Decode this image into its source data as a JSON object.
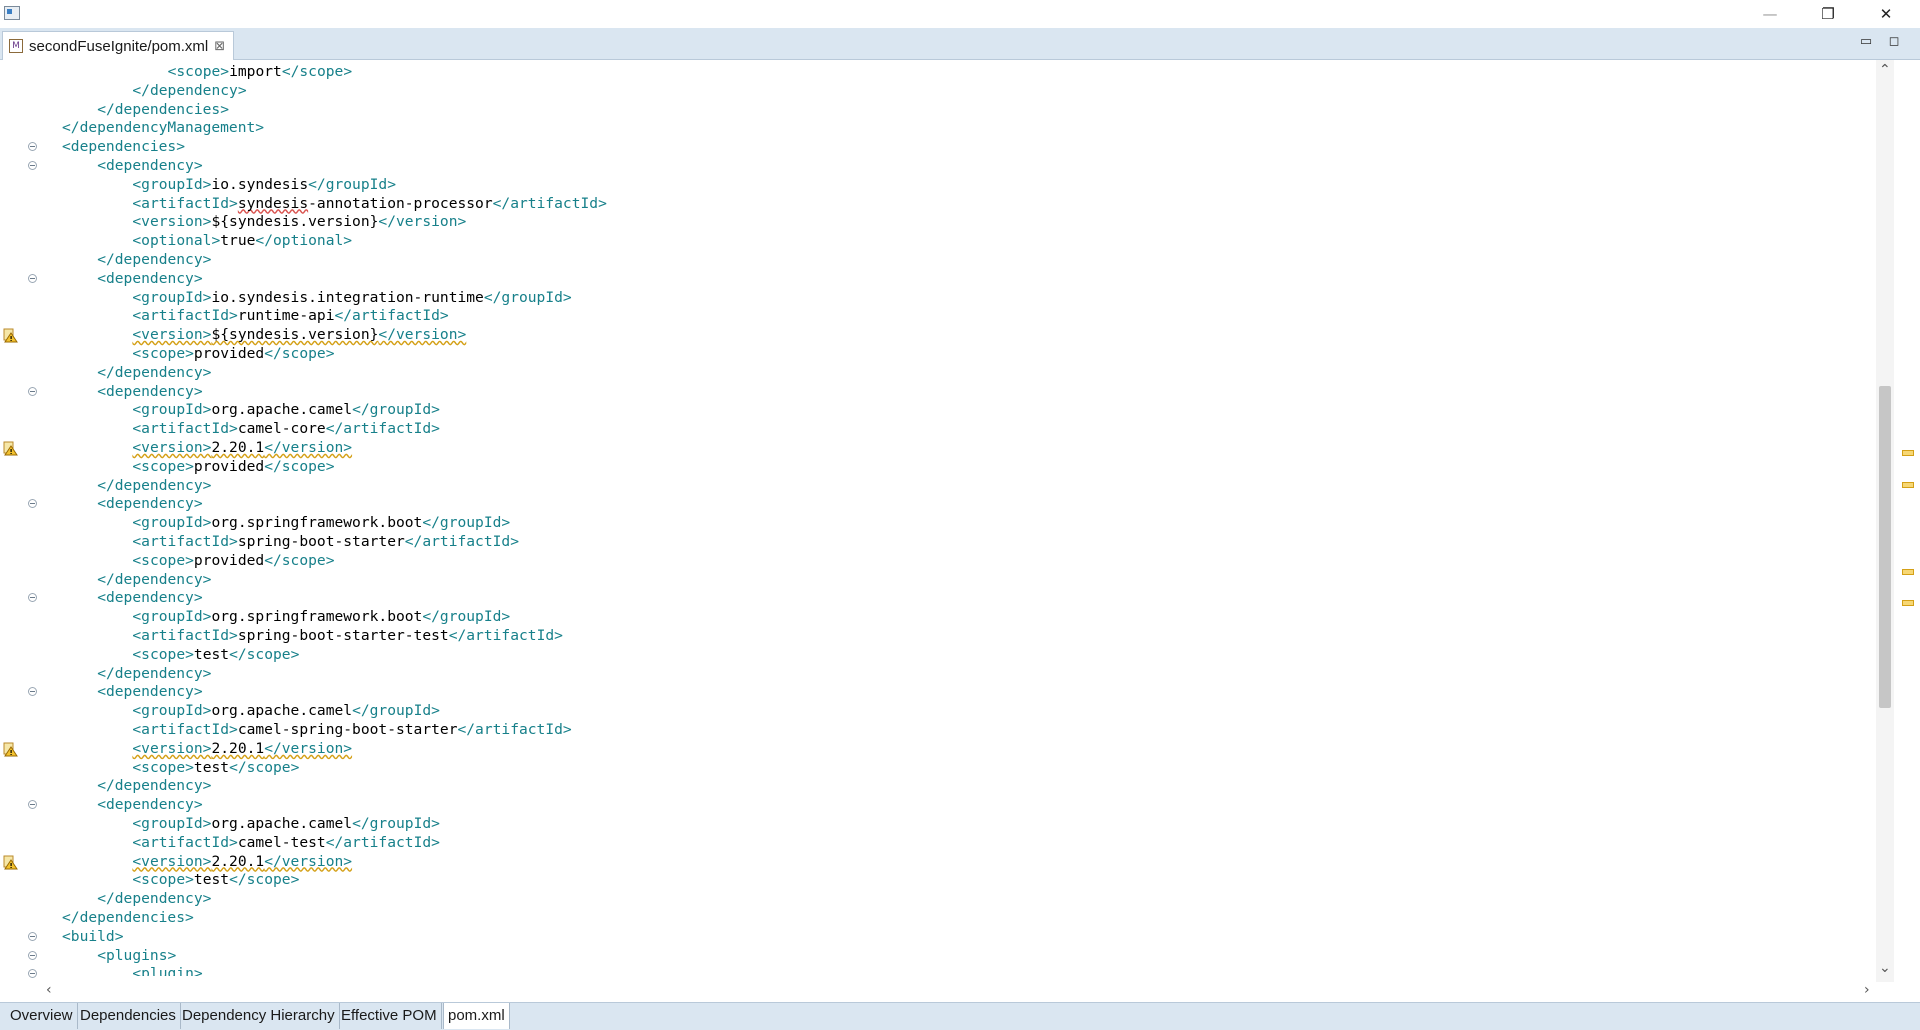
{
  "window": {
    "minimize_glyph": "—",
    "restore_glyph": "❐",
    "close_glyph": "✕"
  },
  "editor_tab": {
    "label": "secondFuseIgnite/pom.xml",
    "icon_letter": "M",
    "close_glyph": "⊠"
  },
  "view_controls": {
    "minimize_glyph": "▭",
    "maximize_glyph": "◻"
  },
  "code_lines": [
    {
      "indent": 6,
      "parts": [
        {
          "k": "tag",
          "t": "<scope>"
        },
        {
          "k": "val",
          "t": "import"
        },
        {
          "k": "tag",
          "t": "</scope>"
        }
      ]
    },
    {
      "indent": 4,
      "parts": [
        {
          "k": "tag",
          "t": "</dependency>"
        }
      ]
    },
    {
      "indent": 2,
      "parts": [
        {
          "k": "tag",
          "t": "</dependencies>"
        }
      ]
    },
    {
      "indent": 0,
      "parts": [
        {
          "k": "tag",
          "t": "</dependencyManagement>"
        }
      ]
    },
    {
      "indent": 0,
      "fold": true,
      "parts": [
        {
          "k": "tag",
          "t": "<dependencies>"
        }
      ]
    },
    {
      "indent": 2,
      "fold": true,
      "parts": [
        {
          "k": "tag",
          "t": "<dependency>"
        }
      ]
    },
    {
      "indent": 4,
      "parts": [
        {
          "k": "tag",
          "t": "<groupId>"
        },
        {
          "k": "val",
          "t": "io.syndesis"
        },
        {
          "k": "tag",
          "t": "</groupId>"
        }
      ]
    },
    {
      "indent": 4,
      "parts": [
        {
          "k": "tag",
          "t": "<artifactId>"
        },
        {
          "k": "val",
          "t": "syndesis",
          "u": "spell"
        },
        {
          "k": "val",
          "t": "-annotation-processor"
        },
        {
          "k": "tag",
          "t": "</artifactId>"
        }
      ]
    },
    {
      "indent": 4,
      "parts": [
        {
          "k": "tag",
          "t": "<version>"
        },
        {
          "k": "val",
          "t": "${syndesis.version}"
        },
        {
          "k": "tag",
          "t": "</version>"
        }
      ]
    },
    {
      "indent": 4,
      "parts": [
        {
          "k": "tag",
          "t": "<optional>"
        },
        {
          "k": "val",
          "t": "true"
        },
        {
          "k": "tag",
          "t": "</optional>"
        }
      ]
    },
    {
      "indent": 2,
      "parts": [
        {
          "k": "tag",
          "t": "</dependency>"
        }
      ]
    },
    {
      "indent": 2,
      "fold": true,
      "parts": [
        {
          "k": "tag",
          "t": "<dependency>"
        }
      ]
    },
    {
      "indent": 4,
      "parts": [
        {
          "k": "tag",
          "t": "<groupId>"
        },
        {
          "k": "val",
          "t": "io.syndesis.integration-runtime"
        },
        {
          "k": "tag",
          "t": "</groupId>"
        }
      ]
    },
    {
      "indent": 4,
      "parts": [
        {
          "k": "tag",
          "t": "<artifactId>"
        },
        {
          "k": "val",
          "t": "runtime-api"
        },
        {
          "k": "tag",
          "t": "</artifactId>"
        }
      ]
    },
    {
      "indent": 4,
      "warn": true,
      "parts": [
        {
          "k": "tag",
          "t": "<version>",
          "u": "warn"
        },
        {
          "k": "val",
          "t": "${syndesis.version}",
          "u": "warn"
        },
        {
          "k": "tag",
          "t": "</version>",
          "u": "warn"
        }
      ]
    },
    {
      "indent": 4,
      "parts": [
        {
          "k": "tag",
          "t": "<scope>"
        },
        {
          "k": "val",
          "t": "provided"
        },
        {
          "k": "tag",
          "t": "</scope>"
        }
      ]
    },
    {
      "indent": 2,
      "parts": [
        {
          "k": "tag",
          "t": "</dependency>"
        }
      ]
    },
    {
      "indent": 2,
      "fold": true,
      "parts": [
        {
          "k": "tag",
          "t": "<dependency>"
        }
      ]
    },
    {
      "indent": 4,
      "parts": [
        {
          "k": "tag",
          "t": "<groupId>"
        },
        {
          "k": "val",
          "t": "org.apache.camel"
        },
        {
          "k": "tag",
          "t": "</groupId>"
        }
      ]
    },
    {
      "indent": 4,
      "parts": [
        {
          "k": "tag",
          "t": "<artifactId>"
        },
        {
          "k": "val",
          "t": "camel-core"
        },
        {
          "k": "tag",
          "t": "</artifactId>"
        }
      ]
    },
    {
      "indent": 4,
      "warn": true,
      "parts": [
        {
          "k": "tag",
          "t": "<version>",
          "u": "warn"
        },
        {
          "k": "val",
          "t": "2.20.1",
          "u": "warn"
        },
        {
          "k": "tag",
          "t": "</version>",
          "u": "warn"
        }
      ]
    },
    {
      "indent": 4,
      "parts": [
        {
          "k": "tag",
          "t": "<scope>"
        },
        {
          "k": "val",
          "t": "provided"
        },
        {
          "k": "tag",
          "t": "</scope>"
        }
      ]
    },
    {
      "indent": 2,
      "parts": [
        {
          "k": "tag",
          "t": "</dependency>"
        }
      ]
    },
    {
      "indent": 2,
      "fold": true,
      "parts": [
        {
          "k": "tag",
          "t": "<dependency>"
        }
      ]
    },
    {
      "indent": 4,
      "parts": [
        {
          "k": "tag",
          "t": "<groupId>"
        },
        {
          "k": "val",
          "t": "org.springframework.boot"
        },
        {
          "k": "tag",
          "t": "</groupId>"
        }
      ]
    },
    {
      "indent": 4,
      "parts": [
        {
          "k": "tag",
          "t": "<artifactId>"
        },
        {
          "k": "val",
          "t": "spring-boot-starter"
        },
        {
          "k": "tag",
          "t": "</artifactId>"
        }
      ]
    },
    {
      "indent": 4,
      "parts": [
        {
          "k": "tag",
          "t": "<scope>"
        },
        {
          "k": "val",
          "t": "provided"
        },
        {
          "k": "tag",
          "t": "</scope>"
        }
      ]
    },
    {
      "indent": 2,
      "parts": [
        {
          "k": "tag",
          "t": "</dependency>"
        }
      ]
    },
    {
      "indent": 2,
      "fold": true,
      "parts": [
        {
          "k": "tag",
          "t": "<dependency>"
        }
      ]
    },
    {
      "indent": 4,
      "parts": [
        {
          "k": "tag",
          "t": "<groupId>"
        },
        {
          "k": "val",
          "t": "org.springframework.boot"
        },
        {
          "k": "tag",
          "t": "</groupId>"
        }
      ]
    },
    {
      "indent": 4,
      "parts": [
        {
          "k": "tag",
          "t": "<artifactId>"
        },
        {
          "k": "val",
          "t": "spring-boot-starter-test"
        },
        {
          "k": "tag",
          "t": "</artifactId>"
        }
      ]
    },
    {
      "indent": 4,
      "parts": [
        {
          "k": "tag",
          "t": "<scope>"
        },
        {
          "k": "val",
          "t": "test"
        },
        {
          "k": "tag",
          "t": "</scope>"
        }
      ]
    },
    {
      "indent": 2,
      "parts": [
        {
          "k": "tag",
          "t": "</dependency>"
        }
      ]
    },
    {
      "indent": 2,
      "fold": true,
      "parts": [
        {
          "k": "tag",
          "t": "<dependency>"
        }
      ]
    },
    {
      "indent": 4,
      "parts": [
        {
          "k": "tag",
          "t": "<groupId>"
        },
        {
          "k": "val",
          "t": "org.apache.camel"
        },
        {
          "k": "tag",
          "t": "</groupId>"
        }
      ]
    },
    {
      "indent": 4,
      "parts": [
        {
          "k": "tag",
          "t": "<artifactId>"
        },
        {
          "k": "val",
          "t": "camel-spring-boot-starter"
        },
        {
          "k": "tag",
          "t": "</artifactId>"
        }
      ]
    },
    {
      "indent": 4,
      "warn": true,
      "parts": [
        {
          "k": "tag",
          "t": "<version>",
          "u": "warn"
        },
        {
          "k": "val",
          "t": "2.20.1",
          "u": "warn"
        },
        {
          "k": "tag",
          "t": "</version>",
          "u": "warn"
        }
      ]
    },
    {
      "indent": 4,
      "parts": [
        {
          "k": "tag",
          "t": "<scope>"
        },
        {
          "k": "val",
          "t": "test"
        },
        {
          "k": "tag",
          "t": "</scope>"
        }
      ]
    },
    {
      "indent": 2,
      "parts": [
        {
          "k": "tag",
          "t": "</dependency>"
        }
      ]
    },
    {
      "indent": 2,
      "fold": true,
      "parts": [
        {
          "k": "tag",
          "t": "<dependency>"
        }
      ]
    },
    {
      "indent": 4,
      "parts": [
        {
          "k": "tag",
          "t": "<groupId>"
        },
        {
          "k": "val",
          "t": "org.apache.camel"
        },
        {
          "k": "tag",
          "t": "</groupId>"
        }
      ]
    },
    {
      "indent": 4,
      "parts": [
        {
          "k": "tag",
          "t": "<artifactId>"
        },
        {
          "k": "val",
          "t": "camel-test"
        },
        {
          "k": "tag",
          "t": "</artifactId>"
        }
      ]
    },
    {
      "indent": 4,
      "warn": true,
      "parts": [
        {
          "k": "tag",
          "t": "<version>",
          "u": "warn"
        },
        {
          "k": "val",
          "t": "2.20.1",
          "u": "warn"
        },
        {
          "k": "tag",
          "t": "</version>",
          "u": "warn"
        }
      ]
    },
    {
      "indent": 4,
      "parts": [
        {
          "k": "tag",
          "t": "<scope>"
        },
        {
          "k": "val",
          "t": "test"
        },
        {
          "k": "tag",
          "t": "</scope>"
        }
      ]
    },
    {
      "indent": 2,
      "parts": [
        {
          "k": "tag",
          "t": "</dependency>"
        }
      ]
    },
    {
      "indent": 0,
      "parts": [
        {
          "k": "tag",
          "t": "</dependencies>"
        }
      ]
    },
    {
      "indent": 0,
      "fold": true,
      "parts": [
        {
          "k": "tag",
          "t": "<build>"
        }
      ]
    },
    {
      "indent": 2,
      "fold": true,
      "parts": [
        {
          "k": "tag",
          "t": "<plugins>"
        }
      ]
    },
    {
      "indent": 4,
      "fold": true,
      "parts": [
        {
          "k": "tag",
          "t": "<plugin>"
        }
      ]
    }
  ],
  "bottom_tabs": [
    {
      "label": "Overview",
      "active": false
    },
    {
      "label": "Dependencies",
      "active": false
    },
    {
      "label": "Dependency Hierarchy",
      "active": false
    },
    {
      "label": "Effective POM",
      "active": false
    },
    {
      "label": "pom.xml",
      "active": true
    }
  ],
  "colors": {
    "tag": "#17808a",
    "text": "#000000",
    "warning": "#d4a017",
    "tab_bar": "#dae6f1"
  }
}
